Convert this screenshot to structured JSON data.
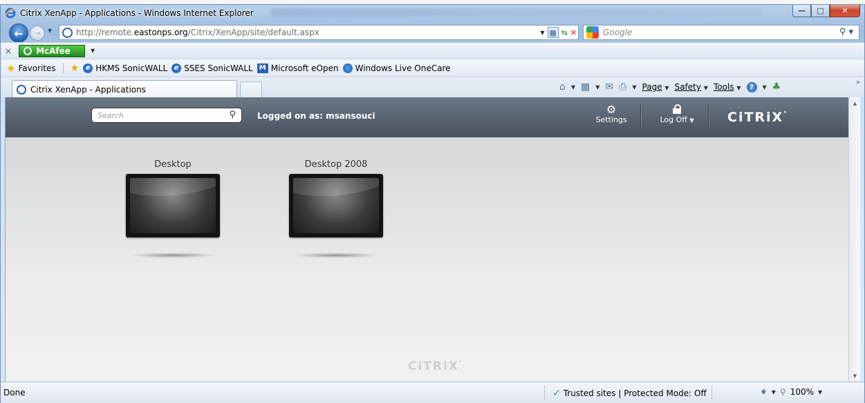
{
  "window": {
    "title": "Citrix XenApp - Applications - Windows Internet Explorer"
  },
  "address_bar": {
    "url_prefix": "http://remote.",
    "url_host": "eastonps.org",
    "url_path": "/Citrix/XenApp/site/default.aspx"
  },
  "search_bar": {
    "placeholder": "Google"
  },
  "toolbar": {
    "close_label": "×",
    "mcafee_label": "McAfee"
  },
  "favorites": {
    "label": "Favorites",
    "items": [
      {
        "label": "HKMS SonicWALL",
        "icon": "ie-icon"
      },
      {
        "label": "SSES SonicWALL",
        "icon": "ie-icon"
      },
      {
        "label": "Microsoft eOpen",
        "icon": "microsoft-icon"
      },
      {
        "label": "Windows Live OneCare",
        "icon": "windows-live-icon"
      }
    ]
  },
  "tabs": [
    {
      "label": "Citrix XenApp - Applications",
      "active": true
    }
  ],
  "command_bar": {
    "page": "Page",
    "safety": "Safety",
    "tools": "Tools"
  },
  "citrix": {
    "search_placeholder": "Search",
    "logged_on": "Logged on as: msansouci",
    "settings": "Settings",
    "log_off": "Log Off",
    "logo": "CiTRiX",
    "footer_logo": "CiTRiX"
  },
  "apps": [
    {
      "name": "Desktop"
    },
    {
      "name": "Desktop 2008"
    }
  ],
  "status_bar": {
    "status": "Done",
    "zone": "Trusted sites | Protected Mode: Off",
    "zoom": "100%"
  },
  "colors": {
    "citrix_header": "#555d68",
    "mcafee_green": "#2e9a2e",
    "content_bg": "#e6e7e8"
  }
}
